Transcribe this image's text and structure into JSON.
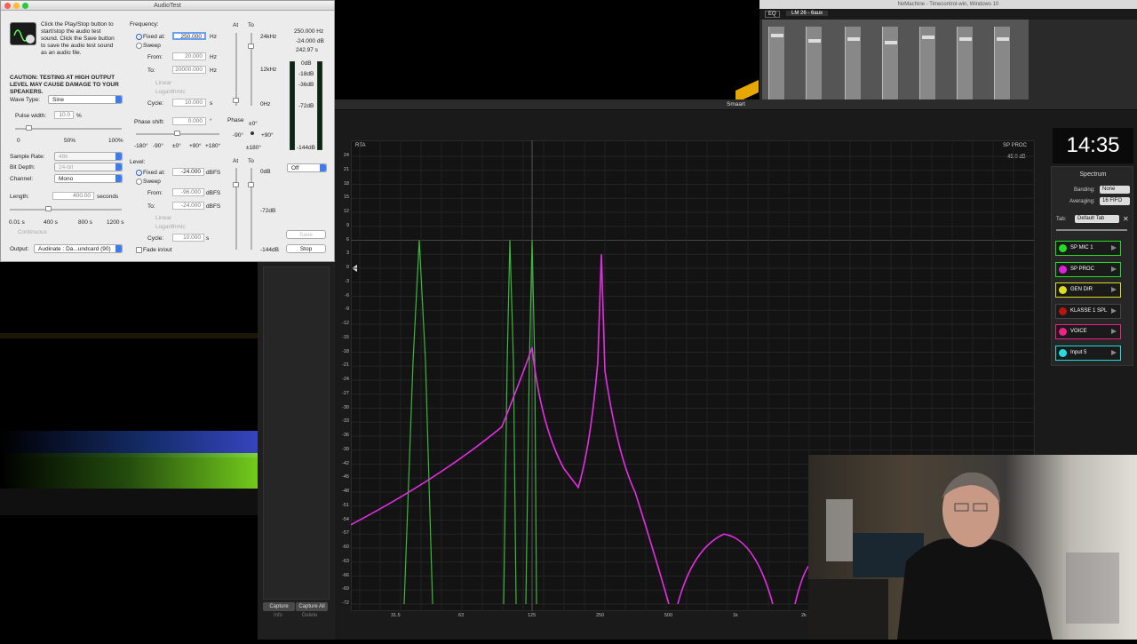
{
  "audiotest": {
    "title": "AudioTest",
    "instructions": "Click the Play/Stop button to start/stop the audio test sound. Click the Save button to save the audio test sound as an audio file.",
    "caution": "CAUTION: TESTING AT HIGH OUTPUT LEVEL MAY CAUSE DAMAGE TO YOUR SPEAKERS.",
    "wave_type_label": "Wave Type:",
    "wave_type": "Sine",
    "pulse_width_label": "Pulse width:",
    "pulse_width": "10.0",
    "pulse_unit": "%",
    "pulse_ticks": [
      "0",
      "50%",
      "100%"
    ],
    "sample_rate_label": "Sample Rate:",
    "sample_rate": "48k",
    "bit_depth_label": "Bit Depth:",
    "bit_depth": "24-bit",
    "channel_label": "Channel:",
    "channel": "Mono",
    "length_label": "Length:",
    "length": "400.00",
    "length_unit": "seconds",
    "length_ticks": [
      "0.01 s",
      "400 s",
      "800 s",
      "1200 s"
    ],
    "continuous": "Continuous",
    "output_label": "Output:",
    "output": "Audinate : Da...undcard (90)",
    "frequency_label": "Frequency:",
    "fixed_label": "Fixed at:",
    "freq_fixed": "250.000",
    "hz": "Hz",
    "sweep_label": "Sweep",
    "from_label": "From:",
    "freq_from": "20.000",
    "to_label": "To:",
    "freq_to": "20000.000",
    "linear_label": "Linear",
    "log_label": "Logarithmic",
    "cycle_label": "Cycle:",
    "cycle": "10.000",
    "s": "s",
    "phase_label": "Phase shift:",
    "phase": "0.000",
    "deg": "°",
    "phase_ticks": [
      "-180°",
      "-90°",
      "±0°",
      "+90°",
      "+180°"
    ],
    "level_label": "Level:",
    "level_fixed": "-24.000",
    "dbfs": "dBFS",
    "level_from": "-96.000",
    "level_to": "-24.000",
    "level_cycle": "10.000",
    "fade_label": "Fade in/out",
    "at_label": "At",
    "to_col_label": "To",
    "freq_scale": [
      "24kHz",
      "12kHz",
      "0Hz"
    ],
    "phase_col": "Phase",
    "phase_scale": [
      "±0°",
      "-90°",
      "+90°",
      "±180°"
    ],
    "level_scale": [
      "0dB",
      "-72dB",
      "-144dB"
    ],
    "readout": [
      "250.000 Hz",
      "-24.000 dB",
      "242.97 s"
    ],
    "meter_scale": [
      "0dB",
      "-18dB",
      "-36dB",
      "-72dB",
      "-144dB"
    ],
    "off_select": "Off",
    "save_label": "Save",
    "stop_label": "Stop"
  },
  "nomachine": {
    "title": "NoMachine - Timecontrol-win, Windows 10",
    "tabs": [
      "EQ",
      "LM 26 - 6aux"
    ]
  },
  "smaart": {
    "title": "Smaart",
    "rta_label": "RTA",
    "trace_label": "SP PROC",
    "peak_readout": "45.0 dB",
    "y_ticks": [
      "24",
      "18",
      "12",
      "6",
      "0",
      "-6",
      "-12",
      "-18",
      "-24",
      "-30",
      "-36",
      "-42",
      "-48",
      "-54",
      "-60",
      "-66",
      "-72"
    ],
    "y_ticks_all": [
      "24",
      "21",
      "18",
      "15",
      "12",
      "9",
      "6",
      "3",
      "0",
      "-3",
      "-6",
      "-9",
      "-12",
      "-15",
      "-18",
      "-21",
      "-24",
      "-27",
      "-30",
      "-33",
      "-36",
      "-39",
      "-42",
      "-45",
      "-48",
      "-51",
      "-54",
      "-57",
      "-60",
      "-63",
      "-66",
      "-69",
      "-72"
    ],
    "x_ticks": [
      "31.5",
      "63",
      "125",
      "250",
      "500",
      "1k",
      "2k"
    ],
    "clock": "14:35",
    "panel_title": "Spectrum",
    "banding_label": "Banding:",
    "banding": "None",
    "averaging_label": "Averaging:",
    "averaging": "16 FIFO",
    "tab_label": "Tab:",
    "tab_value": "Default Tab",
    "tracks": [
      {
        "name": "SP MIC 1",
        "color": "#22dd22",
        "border": "#22dd22"
      },
      {
        "name": "SP PROC",
        "color": "#dd22dd",
        "border": "#22dd22"
      },
      {
        "name": "GEN DIR",
        "color": "#dddd22",
        "border": "#dddd22"
      },
      {
        "name": "KLASSE 1 SPL",
        "color": "#bb1111",
        "border": "#444444"
      },
      {
        "name": "VOICE",
        "color": "#ee2288",
        "border": "#ee2288"
      },
      {
        "name": "Input 5",
        "color": "#22dddd",
        "border": "#22dddd"
      }
    ],
    "capture_label": "Capture",
    "capture_all_label": "Capture All",
    "info_label": "Info",
    "delete_label": "Delete"
  }
}
